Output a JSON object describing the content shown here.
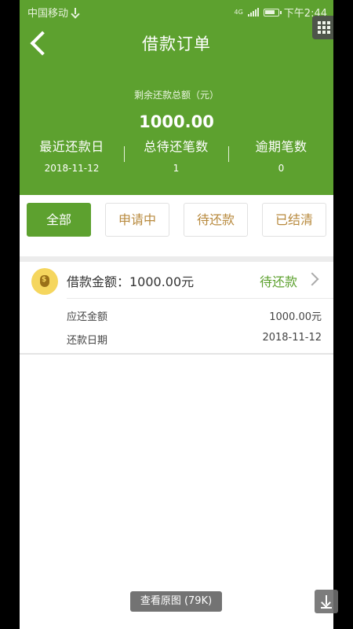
{
  "status_bar": {
    "carrier": "中国移动",
    "signal_label": "4G",
    "time": "下午2:44"
  },
  "header": {
    "title": "借款订单",
    "back_icon": "chevron-left-icon",
    "menu_icon": "grid-icon"
  },
  "summary": {
    "remaining_label": "剩余还款总额（元）",
    "remaining_amount": "1000.00",
    "stats": [
      {
        "label": "最近还款日",
        "value": "2018-11-12"
      },
      {
        "label": "总待还笔数",
        "value": "1"
      },
      {
        "label": "逾期笔数",
        "value": "0"
      }
    ]
  },
  "tabs": [
    {
      "label": "全部",
      "active": true
    },
    {
      "label": "申请中",
      "active": false
    },
    {
      "label": "待还款",
      "active": false
    },
    {
      "label": "已结清",
      "active": false
    }
  ],
  "orders": [
    {
      "icon": "money-bag-icon",
      "amount_text": "借款金额：1000.00元",
      "status": "待还款",
      "rows": [
        {
          "key": "应还金额",
          "value": "1000.00元"
        },
        {
          "key": "还款日期",
          "value": "2018-11-12"
        }
      ]
    }
  ],
  "overlay": {
    "view_original": "查看原图 (79K)",
    "download_icon": "download-icon"
  },
  "colors": {
    "brand_green": "#5da12f",
    "tab_text": "#b88a3e"
  }
}
